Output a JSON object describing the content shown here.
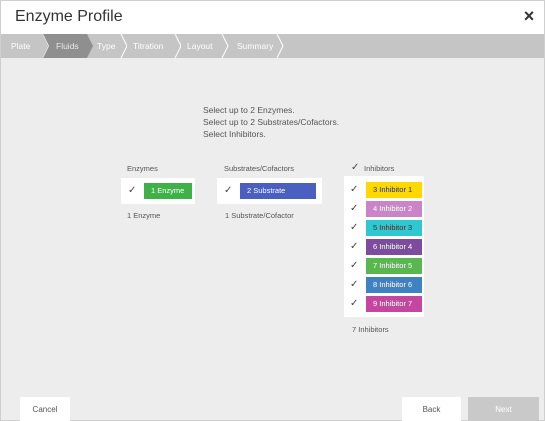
{
  "window": {
    "title": "Enzyme Profile",
    "close_glyph": "×"
  },
  "breadcrumb": {
    "steps": [
      {
        "label": "Plate"
      },
      {
        "label": "Fluids"
      },
      {
        "label": "Type"
      },
      {
        "label": "Titration"
      },
      {
        "label": "Layout"
      },
      {
        "label": "Summary"
      }
    ],
    "active_index": 1
  },
  "instructions": {
    "line1": "Select up to 2 Enzymes.",
    "line2": "Select up to 2 Substrates/Cofactors.",
    "line3": "Select Inhibitors."
  },
  "enzymes": {
    "header": "Enzymes",
    "items": [
      {
        "label": "1  Enzyme",
        "color": "#3fb148",
        "checked": true
      }
    ],
    "summary": "1 Enzyme"
  },
  "substrates": {
    "header": "Substrates/Cofactors",
    "items": [
      {
        "label": "2  Substrate",
        "color": "#4a5fbf",
        "checked": true
      }
    ],
    "summary": "1 Substrate/Cofactor"
  },
  "inhibitors": {
    "header": "Inhibitors",
    "header_checked": true,
    "items": [
      {
        "label": "3  Inhibitor 1",
        "color": "#ffd800",
        "text_color": "#333333",
        "checked": true
      },
      {
        "label": "4  Inhibitor 2",
        "color": "#c985c8",
        "text_color": "#ffffff",
        "checked": true
      },
      {
        "label": "5  Inhibitor 3",
        "color": "#2ec8d2",
        "text_color": "#333333",
        "checked": true
      },
      {
        "label": "6  Inhibitor 4",
        "color": "#7d4c9f",
        "text_color": "#ffffff",
        "checked": true
      },
      {
        "label": "7  Inhibitor 5",
        "color": "#58b84f",
        "text_color": "#ffffff",
        "checked": true
      },
      {
        "label": "8  Inhibitor 6",
        "color": "#3f82c2",
        "text_color": "#ffffff",
        "checked": true
      },
      {
        "label": "9  Inhibitor 7",
        "color": "#c446a0",
        "text_color": "#ffffff",
        "checked": true
      }
    ],
    "summary": "7 Inhibitors"
  },
  "footer": {
    "cancel_label": "Cancel",
    "back_label": "Back",
    "next_label": "Next"
  },
  "colors": {
    "breadcrumb_bg": "#c5c5c5",
    "breadcrumb_active": "#8f8f8f",
    "body_bg": "#ededed"
  },
  "icons": {
    "check": "checkmark-icon",
    "close": "close-icon"
  }
}
